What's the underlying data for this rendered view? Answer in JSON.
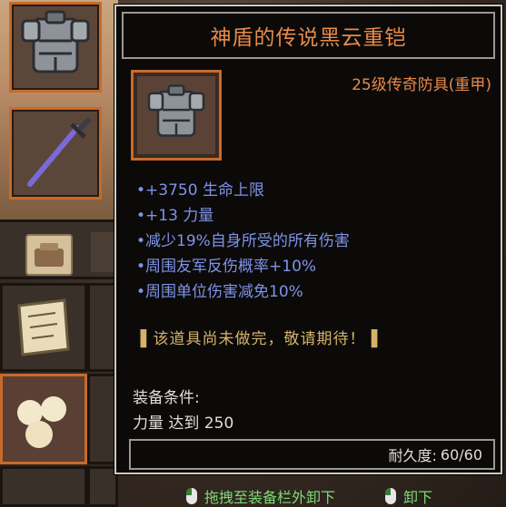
{
  "tooltip": {
    "title": "神盾的传说黑云重铠",
    "rarity": "25级传奇防具(重甲)",
    "stats": [
      "+3750 生命上限",
      "+13 力量",
      "减少19%自身所受的所有伤害",
      "周围友军反伤概率+10%",
      "周围单位伤害减免10%"
    ],
    "wip_note": "该道具尚未做完，敬请期待！",
    "requirement_header": "装备条件:",
    "requirement_value": "力量 达到 250",
    "durability_label": "耐久度:",
    "durability_value": "60/60"
  },
  "hints": {
    "drag_unequip": "拖拽至装备栏外卸下",
    "unequip": "卸下"
  },
  "colors": {
    "title": "#e88a4a",
    "stat_text": "#7f93e8",
    "wip_text": "#d4b26a",
    "hint_text": "#7fd878",
    "rarity_frame": "#c86a2a"
  },
  "icons": {
    "equipped_armor": "armor-icon",
    "equipped_weapon": "sword-icon",
    "inventory_tab": "bag-icon",
    "inventory_scroll": "scroll-icon",
    "inventory_food": "cotton-icon",
    "hint_mouse": "mouse-icon"
  }
}
